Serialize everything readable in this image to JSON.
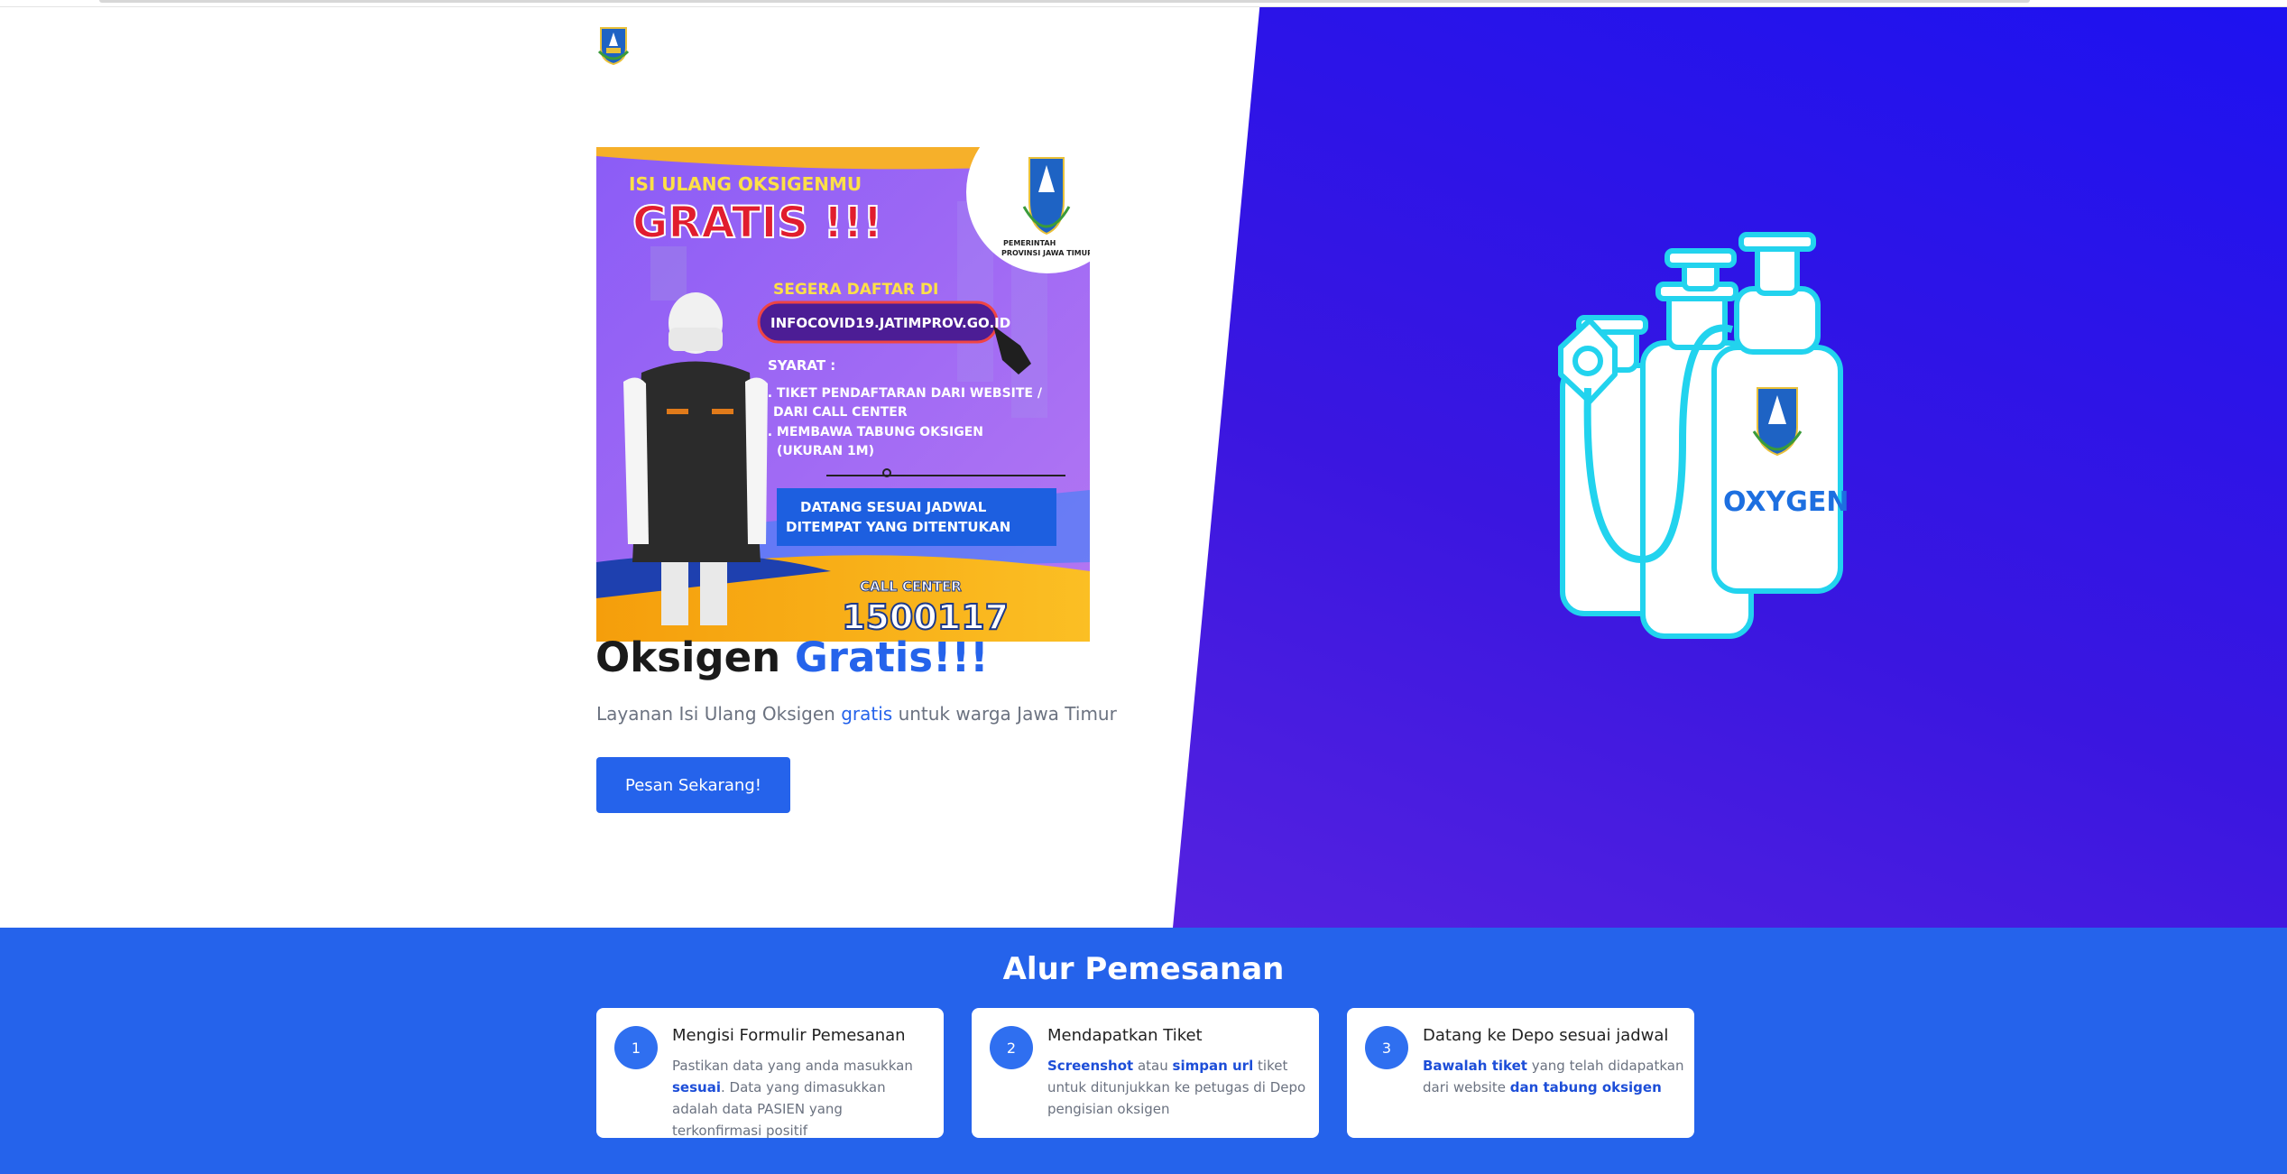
{
  "hero": {
    "title_main": "Oksigen",
    "title_accent": "Gratis!!!",
    "subtitle_pre": "Layanan Isi Ulang Oksigen",
    "subtitle_accent": "gratis",
    "subtitle_post": "untuk warga Jawa Timur",
    "cta_label": "Pesan Sekarang!"
  },
  "poster": {
    "heading_top": "ISI ULANG OKSIGENMU",
    "heading_big": "GRATIS !!!",
    "register_label": "SEGERA DAFTAR DI",
    "url": "INFOCOVID19.JATIMPROV.GO.ID",
    "gov_line1": "PEMERINTAH",
    "gov_line2": "PROVINSI JAWA TIMUR",
    "syarat": "SYARAT :",
    "req1a": "1. TIKET PENDAFTARAN DARI WEBSITE /",
    "req1b": "DARI CALL CENTER",
    "req2a": "2. MEMBAWA TABUNG OKSIGEN",
    "req2b": "(UKURAN 1M)",
    "schedule1": "DATANG SESUAI JADWAL",
    "schedule2": "DITEMPAT YANG DITENTUKAN",
    "call_center_label": "CALL CENTER",
    "call_center_number": "1500117"
  },
  "illustration": {
    "label": "OXYGEN"
  },
  "steps": {
    "title": "Alur Pemesanan",
    "items": [
      {
        "number": "1",
        "title": "Mengisi Formulir Pemesanan",
        "d1": "Pastikan data yang anda masukkan",
        "d2": "sesuai",
        "d3": ". Data yang dimasukkan adalah data PASIEN yang terkonfirmasi positif"
      },
      {
        "number": "2",
        "title": "Mendapatkan Tiket",
        "d1": "Screenshot",
        "d2": "atau",
        "d3": "simpan url",
        "d4": "tiket untuk ditunjukkan ke petugas di Depo pengisian oksigen"
      },
      {
        "number": "3",
        "title": "Datang ke Depo sesuai jadwal",
        "d1": "Bawalah tiket",
        "d2": "yang telah didapatkan dari website",
        "d3": "dan tabung oksigen"
      }
    ]
  },
  "colors": {
    "accent": "#2563eb",
    "hero_gradient_start": "#1d12f0",
    "hero_gradient_end": "#6a2be0",
    "cyan": "#22d3ee"
  },
  "icons": {
    "header_logo": "jatim-crest-icon",
    "oxygen": "oxygen-tanks-icon"
  }
}
